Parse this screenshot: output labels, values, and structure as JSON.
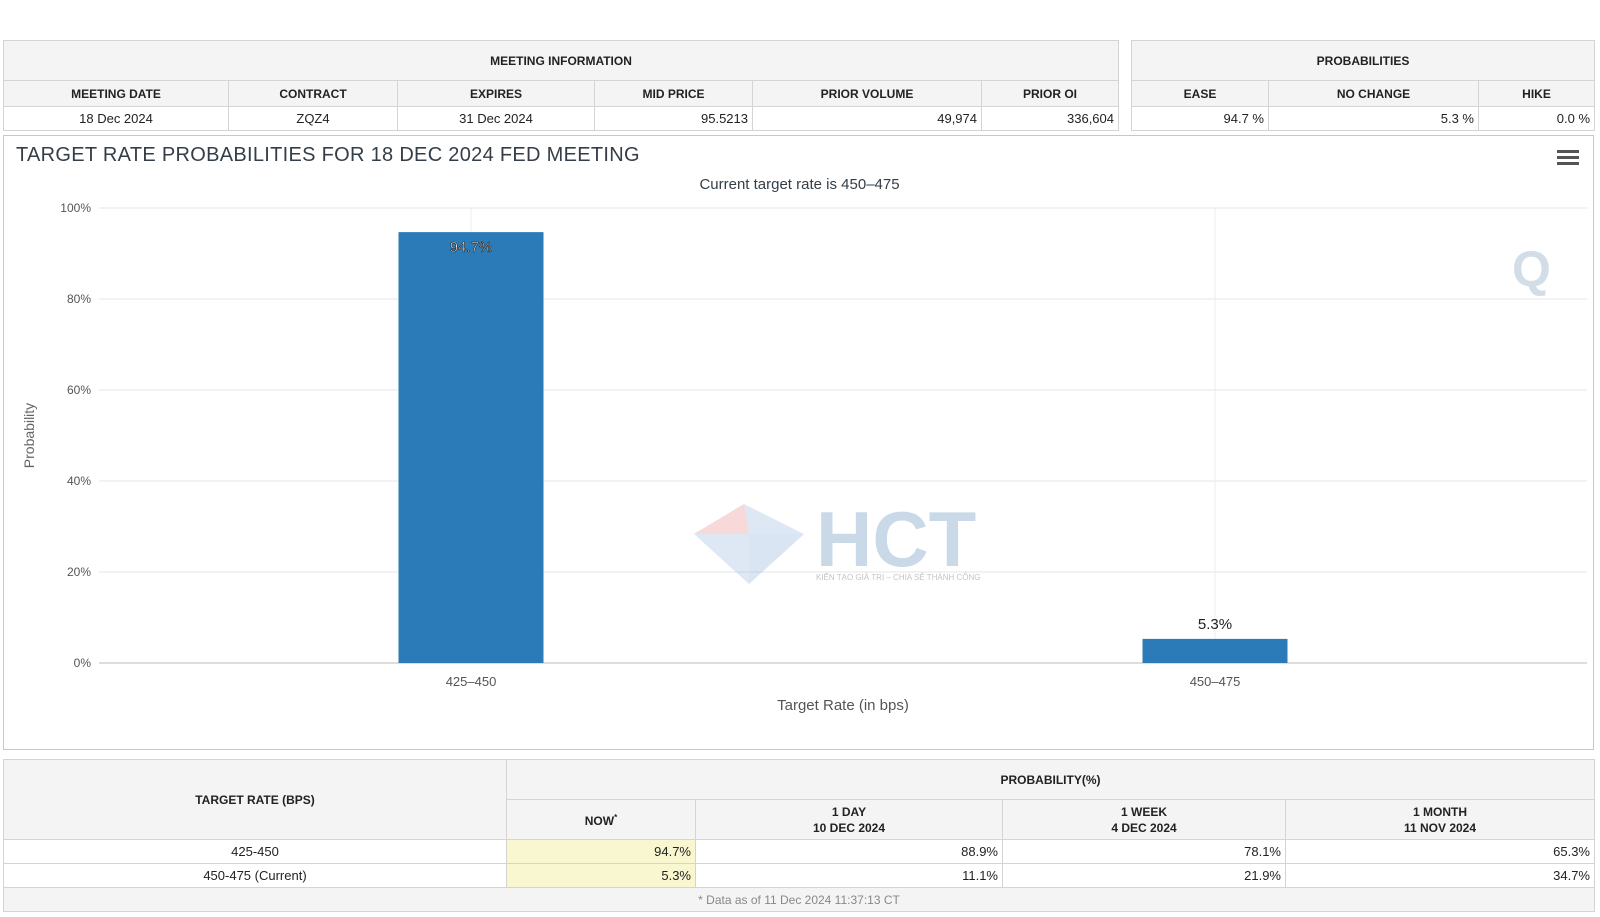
{
  "meeting_info": {
    "group_label": "MEETING INFORMATION",
    "columns": [
      "MEETING DATE",
      "CONTRACT",
      "EXPIRES",
      "MID PRICE",
      "PRIOR VOLUME",
      "PRIOR OI"
    ],
    "row": [
      "18 Dec 2024",
      "ZQZ4",
      "31 Dec 2024",
      "95.5213",
      "49,974",
      "336,604"
    ]
  },
  "probabilities": {
    "group_label": "PROBABILITIES",
    "columns": [
      "EASE",
      "NO CHANGE",
      "HIKE"
    ],
    "row": [
      "94.7 %",
      "5.3 %",
      "0.0 %"
    ]
  },
  "watermark": {
    "brand": "HCT",
    "tagline": "KIẾN TẠO GIÁ TRỊ – CHIA SẺ THÀNH CÔNG",
    "corner_mark": "Q"
  },
  "chart_data": {
    "type": "bar",
    "title": "TARGET RATE PROBABILITIES FOR 18 DEC 2024 FED MEETING",
    "subtitle": "Current target rate is 450–475",
    "xlabel": "Target Rate (in bps)",
    "ylabel": "Probability",
    "categories": [
      "425–450",
      "450–475"
    ],
    "values": [
      94.7,
      5.3
    ],
    "data_labels": [
      "94.7%",
      "5.3%"
    ],
    "ylim": [
      0,
      100
    ],
    "yticks": [
      0,
      20,
      40,
      60,
      80,
      100
    ],
    "ytick_labels": [
      "0%",
      "20%",
      "40%",
      "60%",
      "80%",
      "100%"
    ],
    "grid": true,
    "bar_color": "#2b7bb9"
  },
  "history": {
    "rate_header": "TARGET RATE (BPS)",
    "prob_header": "PROBABILITY(%)",
    "columns": [
      {
        "line1": "NOW",
        "sup": "*",
        "line2": ""
      },
      {
        "line1": "1 DAY",
        "line2": "10 DEC 2024"
      },
      {
        "line1": "1 WEEK",
        "line2": "4 DEC 2024"
      },
      {
        "line1": "1 MONTH",
        "line2": "11 NOV 2024"
      }
    ],
    "rows": [
      {
        "rate": "425-450",
        "values": [
          "94.7%",
          "88.9%",
          "78.1%",
          "65.3%"
        ]
      },
      {
        "rate": "450-475 (Current)",
        "values": [
          "5.3%",
          "11.1%",
          "21.9%",
          "34.7%"
        ]
      }
    ],
    "footnote": "* Data as of 11 Dec 2024 11:37:13 CT"
  }
}
